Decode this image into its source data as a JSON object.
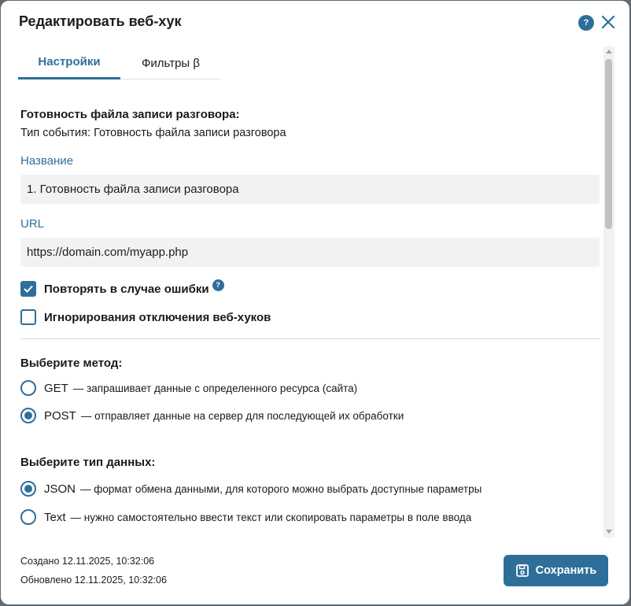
{
  "dialog": {
    "title": "Редактировать веб-хук",
    "help_icon_text": "?",
    "close_icon": "close-icon"
  },
  "tabs": [
    {
      "label": "Настройки",
      "active": true
    },
    {
      "label": "Фильтры β",
      "active": false
    }
  ],
  "event": {
    "heading": "Готовность файла записи разговора:",
    "type_label": "Тип события:",
    "type_value": "Готовность файла записи разговора"
  },
  "fields": {
    "name_label": "Название",
    "name_value": "1. Готовность файла записи разговора",
    "url_label": "URL",
    "url_value": "https://domain.com/myapp.php"
  },
  "options": {
    "retry_label": "Повторять в случае ошибки",
    "retry_checked": true,
    "ignore_label": "Игнорирования отключения веб-хуков",
    "ignore_checked": false
  },
  "method": {
    "heading": "Выберите метод:",
    "options": [
      {
        "label": "GET",
        "desc": "— запрашивает данные с определенного ресурса (сайта)",
        "selected": false
      },
      {
        "label": "POST",
        "desc": "— отправляет данные на сервер для последующей их обработки",
        "selected": true
      }
    ]
  },
  "data_type": {
    "heading": "Выберите тип данных:",
    "options": [
      {
        "label": "JSON",
        "desc": "— формат обмена данными, для которого можно выбрать доступные параметры",
        "selected": true
      },
      {
        "label": "Text",
        "desc": "— нужно самостоятельно ввести текст или скопировать параметры в поле ввода",
        "selected": false
      }
    ]
  },
  "footer": {
    "created": "Создано 12.11.2025, 10:32:06",
    "updated": "Обновлено 12.11.2025, 10:32:06",
    "save_label": "Сохранить"
  },
  "colors": {
    "accent": "#2e6f9a",
    "input_bg": "#f2f2f2",
    "overlay": "#5f6a72"
  }
}
